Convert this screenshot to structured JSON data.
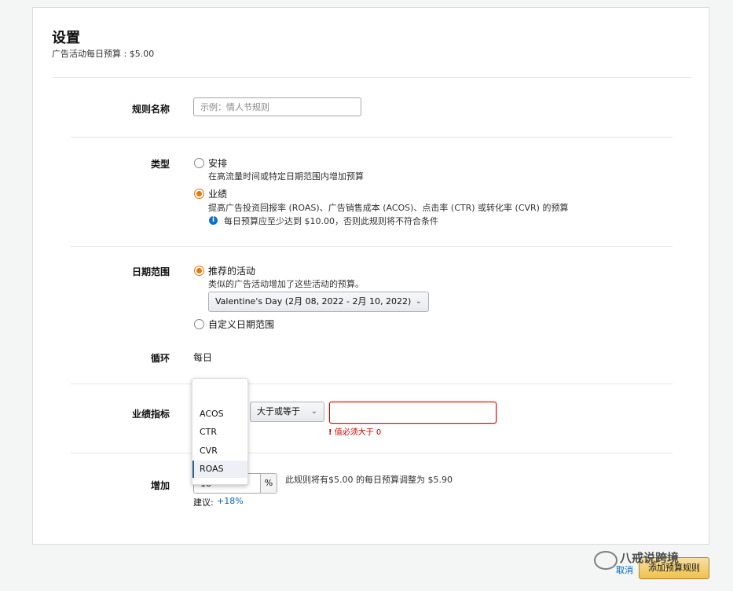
{
  "header": {
    "title": "设置",
    "subtitle": "广告活动每日预算 : $5.00"
  },
  "rule_name": {
    "label": "规则名称",
    "placeholder": "示例：情人节规则"
  },
  "type": {
    "label": "类型",
    "option1_label": "安排",
    "option1_desc": "在高流量时间或特定日期范围内增加预算",
    "option2_label": "业绩",
    "option2_desc": "提高广告投资回报率 (ROAS)、广告销售成本 (ACOS)、点击率 (CTR) 或转化率 (CVR) 的预算",
    "info_text": "每日预算应至少达到 $10.00，否则此规则将不符合条件"
  },
  "date_range": {
    "label": "日期范围",
    "option1_label": "推荐的活动",
    "option1_desc": "类似的广告活动增加了这些活动的预算。",
    "event_select": "Valentine's Day (2月 08, 2022 - 2月 10, 2022)",
    "option2_label": "自定义日期范围"
  },
  "recurrence": {
    "label": "循环",
    "value": "每日"
  },
  "metric": {
    "label": "业绩指标",
    "options": [
      "ACOS",
      "CTR",
      "CVR",
      "ROAS"
    ],
    "selected": "ROAS",
    "operator": "大于或等于",
    "error": "值必须大于 0"
  },
  "increase": {
    "label": "增加",
    "value": "18",
    "unit": "%",
    "summary": "此规则将有$5.00 的每日预算调整为 $5.90",
    "suggest_label": "建议:",
    "suggest_value": "+18%"
  },
  "footer": {
    "cancel": "取消",
    "submit": "添加预算规则"
  },
  "watermark": "八戒说跨境",
  "colors": {
    "accent": "#e47911",
    "link": "#0066c0",
    "error": "#c40000"
  }
}
